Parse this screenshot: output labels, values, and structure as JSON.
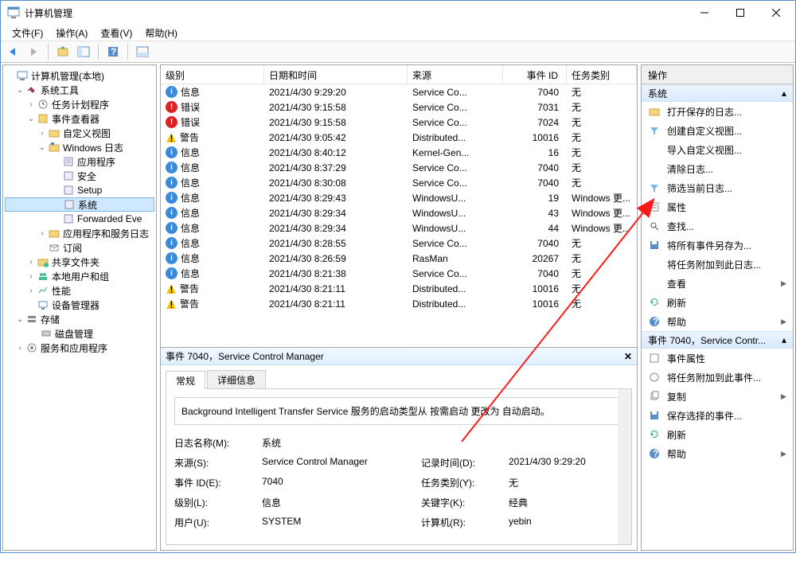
{
  "window": {
    "title": "计算机管理"
  },
  "menu": {
    "file": "文件(F)",
    "action": "操作(A)",
    "view": "查看(V)",
    "help": "帮助(H)"
  },
  "tree": {
    "root": "计算机管理(本地)",
    "tools": "系统工具",
    "scheduler": "任务计划程序",
    "eventviewer": "事件查看器",
    "customviews": "自定义视图",
    "winlogs": "Windows 日志",
    "app": "应用程序",
    "security": "安全",
    "setup": "Setup",
    "system": "系统",
    "forwarded": "Forwarded Eve",
    "appservlogs": "应用程序和服务日志",
    "subscribe": "订阅",
    "shared": "共享文件夹",
    "localusers": "本地用户和组",
    "perf": "性能",
    "devmgr": "设备管理器",
    "storage": "存储",
    "diskmgr": "磁盘管理",
    "servapps": "服务和应用程序"
  },
  "columns": {
    "level": "级别",
    "datetime": "日期和时间",
    "source": "来源",
    "eventid": "事件 ID",
    "category": "任务类别"
  },
  "events": [
    {
      "level": "信息",
      "lvlType": "info",
      "time": "2021/4/30 9:29:20",
      "src": "Service Co...",
      "id": "7040",
      "cat": "无"
    },
    {
      "level": "错误",
      "lvlType": "err",
      "time": "2021/4/30 9:15:58",
      "src": "Service Co...",
      "id": "7031",
      "cat": "无"
    },
    {
      "level": "错误",
      "lvlType": "err",
      "time": "2021/4/30 9:15:58",
      "src": "Service Co...",
      "id": "7024",
      "cat": "无"
    },
    {
      "level": "警告",
      "lvlType": "warn",
      "time": "2021/4/30 9:05:42",
      "src": "Distributed...",
      "id": "10016",
      "cat": "无"
    },
    {
      "level": "信息",
      "lvlType": "info",
      "time": "2021/4/30 8:40:12",
      "src": "Kernel-Gen...",
      "id": "16",
      "cat": "无"
    },
    {
      "level": "信息",
      "lvlType": "info",
      "time": "2021/4/30 8:37:29",
      "src": "Service Co...",
      "id": "7040",
      "cat": "无"
    },
    {
      "level": "信息",
      "lvlType": "info",
      "time": "2021/4/30 8:30:08",
      "src": "Service Co...",
      "id": "7040",
      "cat": "无"
    },
    {
      "level": "信息",
      "lvlType": "info",
      "time": "2021/4/30 8:29:43",
      "src": "WindowsU...",
      "id": "19",
      "cat": "Windows 更..."
    },
    {
      "level": "信息",
      "lvlType": "info",
      "time": "2021/4/30 8:29:34",
      "src": "WindowsU...",
      "id": "43",
      "cat": "Windows 更..."
    },
    {
      "level": "信息",
      "lvlType": "info",
      "time": "2021/4/30 8:29:34",
      "src": "WindowsU...",
      "id": "44",
      "cat": "Windows 更..."
    },
    {
      "level": "信息",
      "lvlType": "info",
      "time": "2021/4/30 8:28:55",
      "src": "Service Co...",
      "id": "7040",
      "cat": "无"
    },
    {
      "level": "信息",
      "lvlType": "info",
      "time": "2021/4/30 8:26:59",
      "src": "RasMan",
      "id": "20267",
      "cat": "无"
    },
    {
      "level": "信息",
      "lvlType": "info",
      "time": "2021/4/30 8:21:38",
      "src": "Service Co...",
      "id": "7040",
      "cat": "无"
    },
    {
      "level": "警告",
      "lvlType": "warn",
      "time": "2021/4/30 8:21:11",
      "src": "Distributed...",
      "id": "10016",
      "cat": "无"
    },
    {
      "level": "警告",
      "lvlType": "warn",
      "time": "2021/4/30 8:21:11",
      "src": "Distributed...",
      "id": "10016",
      "cat": "无"
    }
  ],
  "detail": {
    "title": "事件 7040，Service Control Manager",
    "tabGeneral": "常规",
    "tabDetails": "详细信息",
    "description": "Background Intelligent Transfer Service 服务的启动类型从 按需启动 更改为 自动启动。",
    "lblLogName": "日志名称(M):",
    "logName": "系统",
    "lblSource": "来源(S):",
    "source": "Service Control Manager",
    "lblLogged": "记录时间(D):",
    "logged": "2021/4/30 9:29:20",
    "lblEventId": "事件 ID(E):",
    "eventId": "7040",
    "lblTaskCat": "任务类别(Y):",
    "taskCat": "无",
    "lblLevel": "级别(L):",
    "level": "信息",
    "lblKeywords": "关键字(K):",
    "keywords": "经典",
    "lblUser": "用户(U):",
    "user": "SYSTEM",
    "lblComputer": "计算机(R):",
    "computer": "yebin"
  },
  "actions": {
    "header": "操作",
    "group1": "系统",
    "group2": "事件 7040，Service Contr...",
    "openSaved": "打开保存的日志...",
    "createCustom": "创建自定义视图...",
    "importCustom": "导入自定义视图...",
    "clearLog": "清除日志...",
    "filterCurrent": "筛选当前日志...",
    "properties": "属性",
    "find": "查找...",
    "saveAllAs": "将所有事件另存为...",
    "attachTask": "将任务附加到此日志...",
    "view": "查看",
    "refresh": "刷新",
    "help": "帮助",
    "eventProps": "事件属性",
    "attachTaskEvent": "将任务附加到此事件...",
    "copy": "复制",
    "saveSelected": "保存选择的事件...",
    "refresh2": "刷新",
    "help2": "帮助"
  }
}
